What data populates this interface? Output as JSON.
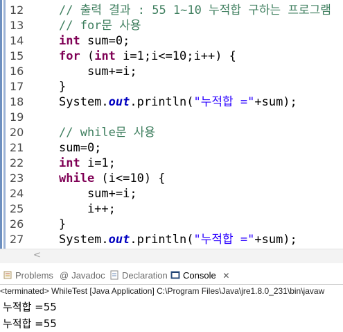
{
  "editor": {
    "lines": [
      {
        "num": "12",
        "parts": [
          [
            "cm",
            "// 출력 결과 : 55 1~10 누적합 구하는 프로그램"
          ]
        ]
      },
      {
        "num": "13",
        "parts": [
          [
            "cm",
            "// for문 사용"
          ]
        ]
      },
      {
        "num": "14",
        "parts": [
          [
            "kw",
            "int"
          ],
          [
            "",
            " sum=0;"
          ]
        ]
      },
      {
        "num": "15",
        "parts": [
          [
            "kw",
            "for"
          ],
          [
            "",
            " ("
          ],
          [
            "kw",
            "int"
          ],
          [
            "",
            " i=1;i<=10;i++) {"
          ]
        ]
      },
      {
        "num": "16",
        "parts": [
          [
            "",
            "    sum+=i;"
          ]
        ]
      },
      {
        "num": "17",
        "parts": [
          [
            "",
            "}"
          ]
        ]
      },
      {
        "num": "18",
        "parts": [
          [
            "",
            "System."
          ],
          [
            "fld",
            "out"
          ],
          [
            "",
            ".println("
          ],
          [
            "st",
            "\"누적합 =\""
          ],
          [
            "",
            "+sum);"
          ]
        ]
      },
      {
        "num": "19",
        "parts": []
      },
      {
        "num": "20",
        "parts": [
          [
            "cm",
            "// while문 사용"
          ]
        ]
      },
      {
        "num": "21",
        "parts": [
          [
            "",
            "sum=0;"
          ]
        ]
      },
      {
        "num": "22",
        "parts": [
          [
            "kw",
            "int"
          ],
          [
            "",
            " i=1;"
          ]
        ]
      },
      {
        "num": "23",
        "parts": [
          [
            "kw",
            "while"
          ],
          [
            "",
            " (i<=10) {"
          ]
        ]
      },
      {
        "num": "24",
        "parts": [
          [
            "",
            "    sum+=i;"
          ]
        ]
      },
      {
        "num": "25",
        "parts": [
          [
            "",
            "    i++;"
          ]
        ]
      },
      {
        "num": "26",
        "parts": [
          [
            "",
            "}"
          ]
        ]
      },
      {
        "num": "27",
        "parts": [
          [
            "",
            "System."
          ],
          [
            "fld",
            "out"
          ],
          [
            "",
            ".println("
          ],
          [
            "st",
            "\"누적합 =\""
          ],
          [
            "",
            "+sum);"
          ]
        ]
      }
    ]
  },
  "tabs": {
    "problems": "Problems",
    "javadoc": "Javadoc",
    "declaration": "Declaration",
    "console": "Console"
  },
  "console": {
    "header": "<terminated> WhileTest [Java Application] C:\\Program Files\\Java\\jre1.8.0_231\\bin\\javaw",
    "output": [
      "누적합 =55",
      "누적합 =55"
    ]
  },
  "colors": {
    "keyword": "#7f0055",
    "comment": "#3f7f5f",
    "string": "#2a00ff",
    "field": "#0000c0"
  }
}
